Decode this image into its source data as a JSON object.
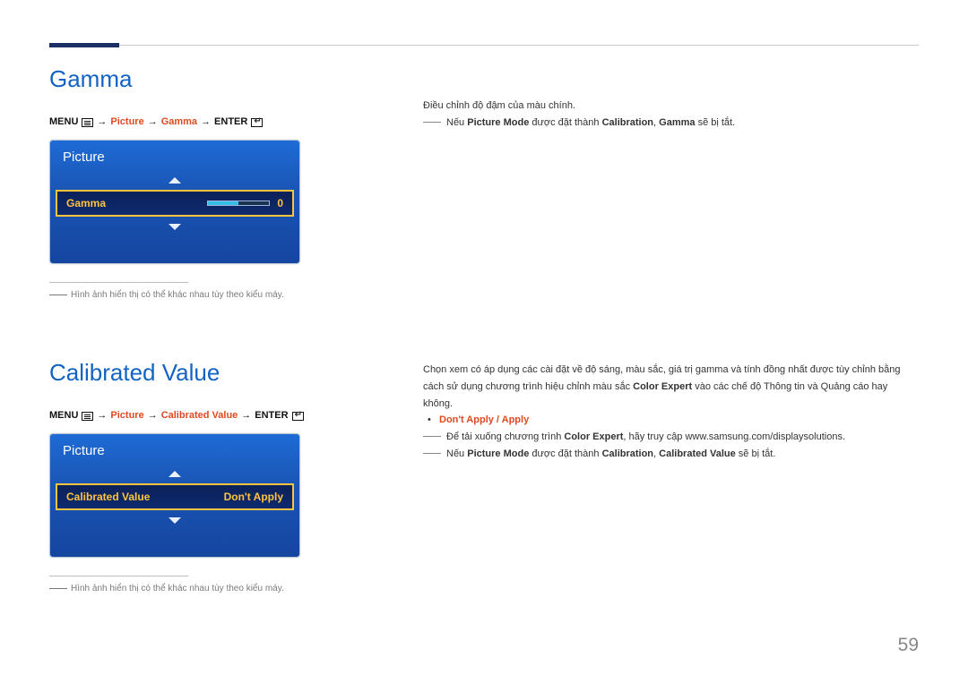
{
  "page_number": "59",
  "gamma": {
    "title": "Gamma",
    "breadcrumb": {
      "menu": "MENU",
      "items": [
        "Picture",
        "Gamma"
      ],
      "enter": "ENTER"
    },
    "osd": {
      "panel_title": "Picture",
      "row_label": "Gamma",
      "row_value": "0"
    },
    "caption": "Hình ảnh hiển thị có thể khác nhau tùy theo kiểu máy.",
    "right": {
      "intro": "Điều chỉnh độ đậm của màu chính.",
      "note_prefix": "Nếu ",
      "note_bold1": "Picture Mode",
      "note_mid": " được đặt thành ",
      "note_bold2": "Calibration",
      "note_sep": ", ",
      "note_bold3": "Gamma",
      "note_suffix": " sẽ bị tắt."
    }
  },
  "calibrated": {
    "title": "Calibrated Value",
    "breadcrumb": {
      "menu": "MENU",
      "items": [
        "Picture",
        "Calibrated Value"
      ],
      "enter": "ENTER"
    },
    "osd": {
      "panel_title": "Picture",
      "row_label": "Calibrated Value",
      "row_value": "Don't Apply"
    },
    "caption": "Hình ảnh hiển thị có thể khác nhau tùy theo kiểu máy.",
    "right": {
      "para_a": "Chọn xem có áp dụng các cài đặt về độ sáng, màu sắc, giá trị gamma và tính đồng nhất được tùy chỉnh bằng cách sử dụng chương trình hiệu chỉnh màu sắc ",
      "para_bold": "Color Expert",
      "para_b": " vào các chế độ Thông tin và Quảng cáo hay không.",
      "apply_options": "Don't Apply / Apply",
      "dl_a": "Để tải xuống chương trình ",
      "dl_bold": "Color Expert",
      "dl_b": ", hãy truy cập www.samsung.com/displaysolutions.",
      "note_prefix": "Nếu ",
      "note_bold1": "Picture Mode",
      "note_mid": " được đặt thành ",
      "note_bold2": "Calibration",
      "note_sep": ", ",
      "note_bold3": "Calibrated Value",
      "note_suffix": " sẽ bị tắt."
    }
  }
}
